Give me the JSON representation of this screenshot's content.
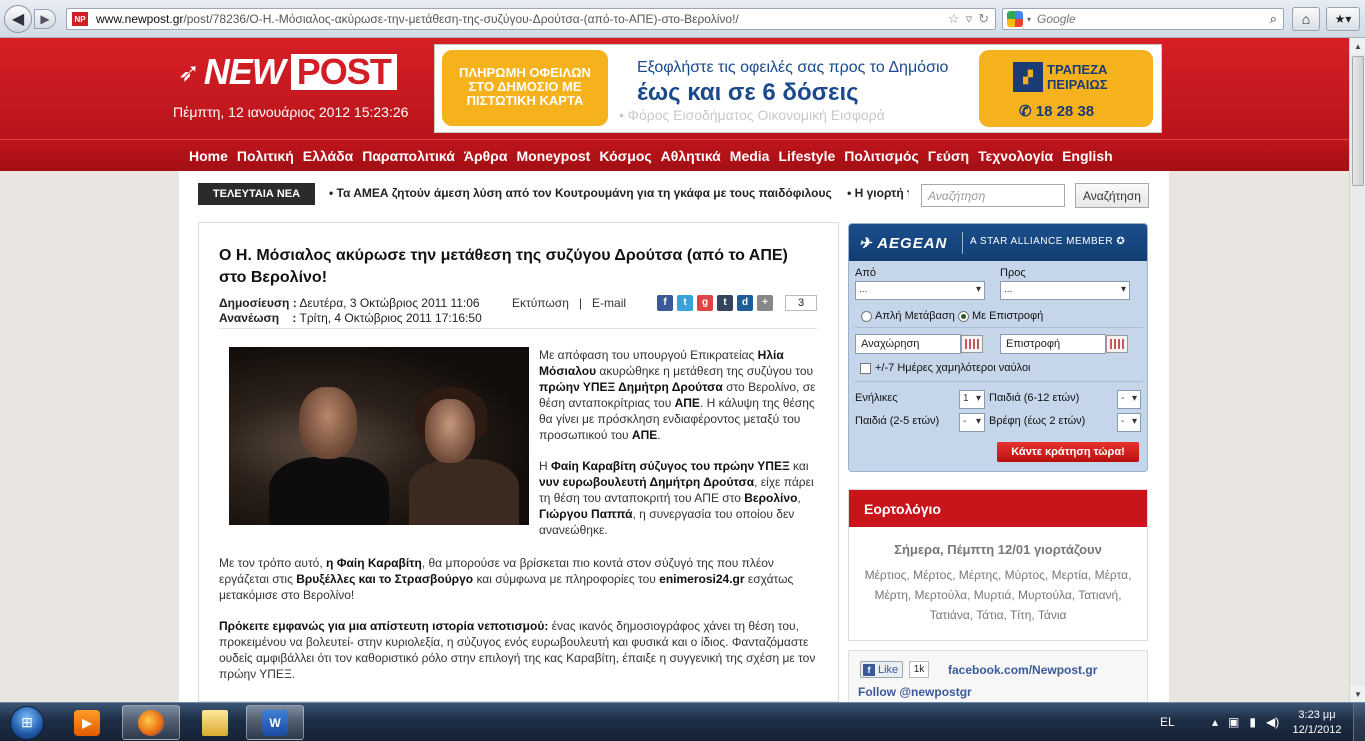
{
  "browser": {
    "url_domain": "www.newpost.gr",
    "url_path": "/post/78236/Ο-Η.-Μόσιαλος-ακύρωσε-την-μετάθεση-της-συζύγου-Δρούτσα-(από-το-ΑΠΕ)-στο-Βερολίνο!/",
    "favicon_text": "NP",
    "search_placeholder": "Google"
  },
  "site": {
    "logo_new": "NEW",
    "logo_post": "POST",
    "date": "Πέμπτη, 12 ιανουάριος 2012 15:23:26"
  },
  "banner": {
    "left_text": "ΠΛΗΡΩΜΗ ΟΦΕΙΛΩΝ ΣΤΟ ΔΗΜΟΣΙΟ ΜΕ ΠΙΣΤΩΤΙΚΗ ΚΑΡΤΑ",
    "line1": "Εξοφλήστε τις οφειλές σας προς το Δημόσιο",
    "line2": "έως και σε 6 δόσεις",
    "line3": "• Φόρος Εισοδήματος Οικονομική Εισφορά",
    "bank_name": "ΤΡΑΠΕΖΑ ΠΕΙΡΑΙΩΣ",
    "bank_phone": "✆ 18 28 38"
  },
  "nav": [
    "Home",
    "Πολιτική",
    "Ελλάδα",
    "Παραπολιτικά",
    "Άρθρα",
    "Moneypost",
    "Κόσμος",
    "Αθλητικά",
    "Media",
    "Lifestyle",
    "Πολιτισμός",
    "Γεύση",
    "Τεχνολογία",
    "English"
  ],
  "ticker": {
    "label": "ΤΕΛΕΥΤΑΙΑ ΝΕΑ",
    "items": [
      "• Τα ΑΜΕΑ ζητούν άμεση λύση από τον Κουτρουμάνη για τη γκάφα με τους παιδόφιλους",
      "• Η γιορτή της Τ"
    ]
  },
  "site_search": {
    "placeholder": "Αναζήτηση",
    "button": "Αναζήτηση"
  },
  "article": {
    "title": "Ο Η. Μόσιαλος ακύρωσε την μετάθεση της συζύγου Δρούτσα (από το ΑΠΕ) στο Βερολίνο!",
    "published_label": "Δημοσίευση :",
    "published_value": "Δευτέρα, 3 Οκτώβριος 2011 11:06",
    "updated_label": "Ανανέωση",
    "updated_value": "Τρίτη, 4 Οκτώβριος 2011 17:16:50",
    "print_label": "Εκτύπωση",
    "separator": "|",
    "email_label": "E-mail",
    "share_count": "3"
  },
  "aegean": {
    "logo": "AEGEAN",
    "alliance": "A STAR ALLIANCE MEMBER ✪",
    "from_label": "Από",
    "to_label": "Προς",
    "from_value": "...",
    "to_value": "...",
    "oneway_label": "Απλή Μετάβαση",
    "return_label": "Με Επιστροφή",
    "depart_value": "Αναχώρηση",
    "return_value": "Επιστροφή",
    "flex_label": "+/-7 Ημέρες χαμηλότεροι ναύλοι",
    "adults_label": "Ενήλικες",
    "adults_value": "1",
    "children612_label": "Παιδιά (6-12 ετών)",
    "children612_value": "-",
    "children25_label": "Παιδιά (2-5 ετών)",
    "children25_value": "-",
    "infants_label": "Βρέφη (έως 2 ετών)",
    "infants_value": "-",
    "book_button": "Κάντε κράτηση τώρα!"
  },
  "eortologio": {
    "title": "Εορτολόγιο",
    "today": "Σήμερα, Πέμπτη 12/01 γιορτάζουν",
    "names": "Μέρτιος, Μέρτος, Μέρτης, Μύρτος, Μερτία, Μέρτα, Μέρτη, Μερτούλα, Μυρτιά, Μυρτούλα, Τατιανή, Τατιάνα, Τάτια, Τίτη, Τάνια"
  },
  "social": {
    "like_label": "Like",
    "like_count": "1k",
    "facebook_link": "facebook.com/Newpost.gr",
    "twitter_link": "Follow @newpostgr"
  },
  "taskbar": {
    "lang": "EL",
    "time": "3:23 μμ",
    "date": "12/1/2012"
  },
  "colors": {
    "brand_red": "#d31e25",
    "nav_red": "#b3131a",
    "aegean_blue": "#1b4f8d",
    "banner_yellow": "#f5b21d"
  }
}
